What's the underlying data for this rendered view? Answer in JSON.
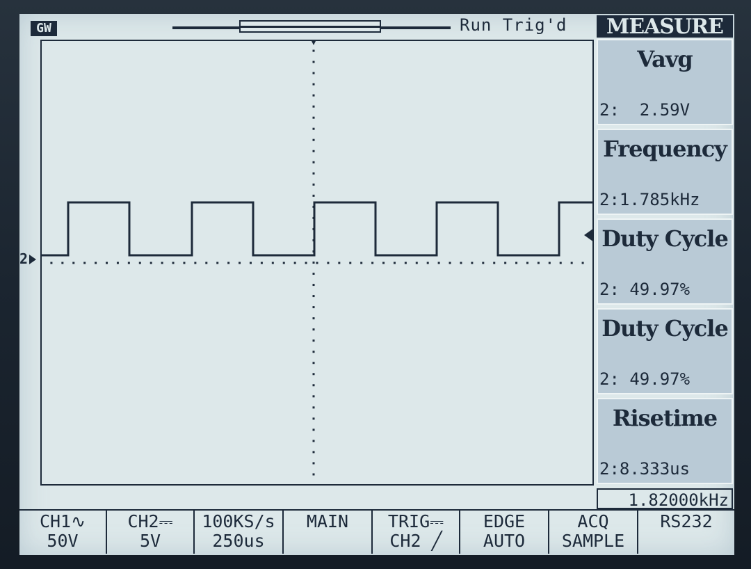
{
  "header": {
    "logo": "GW",
    "status": "Run Trig'd"
  },
  "measure": {
    "title": "MEASURE",
    "items": [
      {
        "label": "Vavg",
        "value": "2:  2.59V"
      },
      {
        "label": "Frequency",
        "value": "2:1.785kHz"
      },
      {
        "label": "Duty Cycle",
        "value": "2: 49.97%"
      },
      {
        "label": "Duty Cycle",
        "value": "2: 49.97%"
      },
      {
        "label": "Risetime",
        "value": "2:8.333us"
      }
    ],
    "counter": "1.82000kHz"
  },
  "channel_marker": "2",
  "softkeys": [
    {
      "line1": "CH1∿",
      "line2": "50V"
    },
    {
      "line1": "CH2⎓",
      "line2": "5V"
    },
    {
      "line1": "100KS/s",
      "line2": "250us"
    },
    {
      "line1": "MAIN",
      "line2": ""
    },
    {
      "line1": "TRIG⎓",
      "line2": "CH2 ╱"
    },
    {
      "line1": "EDGE",
      "line2": "AUTO"
    },
    {
      "line1": "ACQ",
      "line2": "SAMPLE"
    },
    {
      "line1": "RS232",
      "line2": ""
    }
  ],
  "colors": {
    "screen": "#dde8ea",
    "trace": "#1d2a3a",
    "panel": "#b9cad6"
  }
}
